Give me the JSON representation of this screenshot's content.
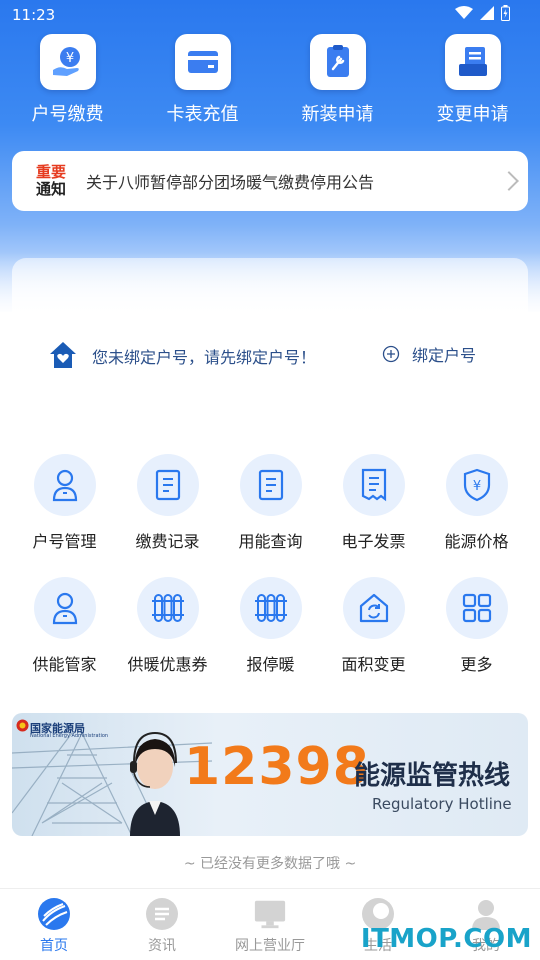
{
  "status_bar": {
    "time": "11:23"
  },
  "quick_actions": [
    {
      "label": "户号缴费",
      "icon": "yuan-hand-icon"
    },
    {
      "label": "卡表充值",
      "icon": "card-icon"
    },
    {
      "label": "新装申请",
      "icon": "wrench-doc-icon"
    },
    {
      "label": "变更申请",
      "icon": "change-doc-icon"
    }
  ],
  "notice": {
    "badge_line1": "重要",
    "badge_line2": "通知",
    "text": "关于八师暂停部分团场暖气缴费停用公告"
  },
  "bind": {
    "message": "您未绑定户号，请先绑定户号！",
    "button_label": "绑定户号"
  },
  "services": [
    [
      {
        "label": "户号管理",
        "icon": "user-icon"
      },
      {
        "label": "缴费记录",
        "icon": "document-icon"
      },
      {
        "label": "用能查询",
        "icon": "document-icon"
      },
      {
        "label": "电子发票",
        "icon": "receipt-icon"
      },
      {
        "label": "能源价格",
        "icon": "yuan-shield-icon"
      }
    ],
    [
      {
        "label": "供能管家",
        "icon": "user-icon"
      },
      {
        "label": "供暖优惠券",
        "icon": "radiator-icon"
      },
      {
        "label": "报停暖",
        "icon": "radiator-icon"
      },
      {
        "label": "面积变更",
        "icon": "house-refresh-icon"
      },
      {
        "label": "更多",
        "icon": "grid-icon"
      }
    ]
  ],
  "banner": {
    "org": "国家能源局",
    "org_en": "National Energy Administration",
    "number": "12398",
    "title": "能源监管热线",
    "subtitle": "Regulatory Hotline"
  },
  "end_text": "~ 已经没有更多数据了哦 ~",
  "tabs": [
    {
      "label": "首页",
      "active": true
    },
    {
      "label": "资讯",
      "active": false
    },
    {
      "label": "网上营业厅",
      "active": false
    },
    {
      "label": "生活",
      "active": false
    },
    {
      "label": "我的",
      "active": false
    }
  ],
  "watermark": "ITMOP.COM",
  "colors": {
    "primary": "#2a78ee",
    "accent": "#f27a1a",
    "notice_red": "#e63b1f"
  }
}
